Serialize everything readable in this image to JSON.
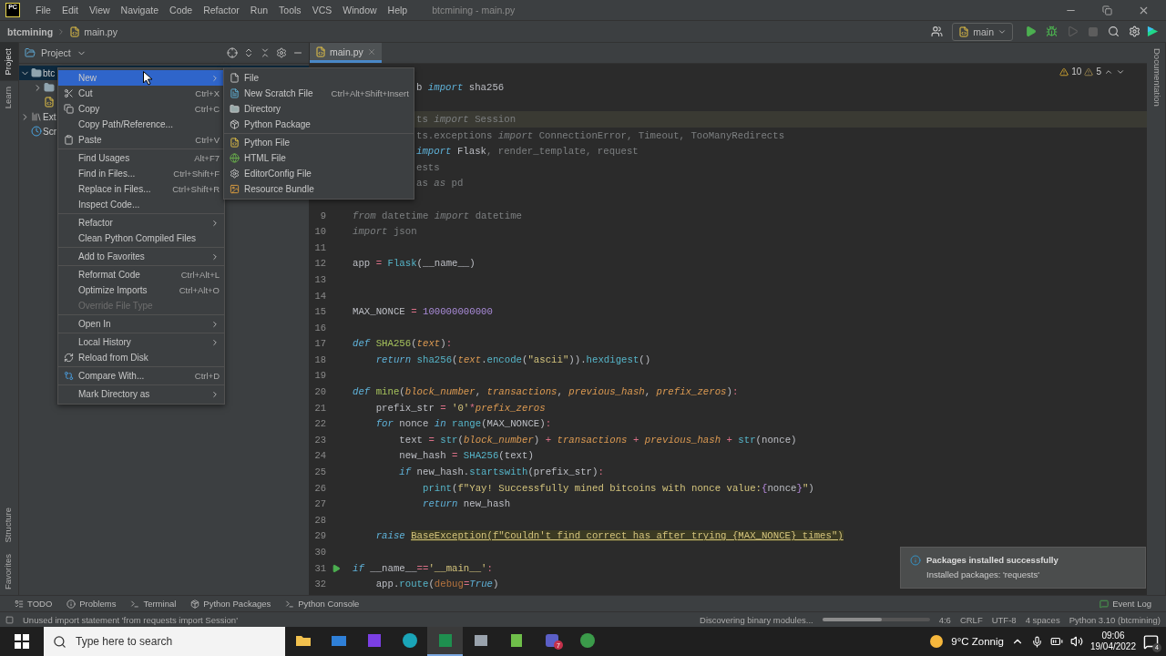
{
  "title_bar": {
    "logo": "PC",
    "menus": [
      "File",
      "Edit",
      "View",
      "Navigate",
      "Code",
      "Refactor",
      "Run",
      "Tools",
      "VCS",
      "Window",
      "Help"
    ],
    "title": "btcmining - main.py"
  },
  "nav_bar": {
    "breadcrumb": [
      "btcmining",
      "main.py"
    ],
    "run_config": "main",
    "toolbar": [
      {
        "kind": "run",
        "disabled": false
      },
      {
        "kind": "debug",
        "disabled": false
      },
      {
        "kind": "coverage",
        "disabled": true
      },
      {
        "kind": "stop",
        "disabled": true
      },
      {
        "kind": "search",
        "disabled": false
      },
      {
        "kind": "settings",
        "disabled": false
      }
    ]
  },
  "left_stripe": {
    "top": [
      {
        "label": "Project",
        "selected": true
      },
      {
        "label": "Learn",
        "selected": false
      }
    ],
    "bottom": [
      {
        "label": "Structure",
        "selected": false
      },
      {
        "label": "Favorites",
        "selected": false
      }
    ]
  },
  "right_stripe": {
    "label": "Documentation"
  },
  "project_panel": {
    "title": "Project",
    "tree": [
      {
        "kind": "folder",
        "label": "btc",
        "expanded": true,
        "selected": true,
        "children": [
          {
            "kind": "folder",
            "expanded": false
          },
          {
            "kind": "file"
          }
        ]
      },
      {
        "kind": "library",
        "label": "Ext",
        "expanded": false,
        "selected": false
      },
      {
        "kind": "scratches",
        "selected": false,
        "label": "Scr"
      }
    ]
  },
  "editor": {
    "tab": {
      "label": "main.py",
      "selected": true
    },
    "warnings": "10",
    "weak_warnings": "5",
    "lines": [
      {
        "kind": "partial",
        "tokens": [
          {
            "text": "b ",
            "kind": "plain"
          },
          {
            "text": "import",
            "kind": "keyword"
          },
          {
            "text": " sha256",
            "kind": "plain"
          }
        ]
      },
      {
        "kind": "blank"
      },
      {
        "kind": "caret",
        "tokens": [
          {
            "text": "ts ",
            "kind": "unused"
          },
          {
            "text": "import",
            "kind": "unused_keyword"
          },
          {
            "text": " Session",
            "kind": "unused"
          }
        ]
      },
      {
        "kind": "partial",
        "tokens": [
          {
            "text": "ts.exceptions ",
            "kind": "unused"
          },
          {
            "text": "import",
            "kind": "unused_keyword"
          },
          {
            "text": " ConnectionError, Timeout, TooManyRedirects",
            "kind": "unused"
          }
        ]
      },
      {
        "kind": "partial",
        "tokens": [
          {
            "text": "import",
            "kind": "keyword"
          },
          {
            "text": " Flask",
            "kind": "plain"
          },
          {
            "text": ", render_template, request",
            "kind": "unused"
          }
        ]
      },
      {
        "kind": "partial",
        "tokens": [
          {
            "text": "ests",
            "kind": "unused"
          }
        ]
      },
      {
        "kind": "partial",
        "tokens": [
          {
            "text": "as ",
            "kind": "unused"
          },
          {
            "text": "as",
            "kind": "unused_keyword"
          },
          {
            "text": " pd",
            "kind": "unused"
          }
        ]
      },
      {
        "kind": "blank"
      },
      {
        "kind": "code",
        "number": "9",
        "tokens": [
          {
            "text": "from",
            "kind": "unused_keyword"
          },
          {
            "text": " datetime ",
            "kind": "unused"
          },
          {
            "text": "import",
            "kind": "unused_keyword"
          },
          {
            "text": " datetime",
            "kind": "unused"
          }
        ]
      },
      {
        "kind": "code",
        "number": "10",
        "tokens": [
          {
            "text": "import",
            "kind": "unused_keyword"
          },
          {
            "text": " json",
            "kind": "unused"
          }
        ]
      },
      {
        "kind": "code",
        "number": "11"
      },
      {
        "kind": "code",
        "number": "12",
        "tokens": [
          {
            "text": "app ",
            "kind": "plain"
          },
          {
            "text": "= ",
            "kind": "operator"
          },
          {
            "text": "Flask",
            "kind": "call"
          },
          {
            "text": "(__name__)",
            "kind": "plain"
          }
        ]
      },
      {
        "kind": "code",
        "number": "13"
      },
      {
        "kind": "code",
        "number": "14"
      },
      {
        "kind": "code",
        "number": "15",
        "tokens": [
          {
            "text": "MAX_NONCE ",
            "kind": "plain"
          },
          {
            "text": "= ",
            "kind": "operator"
          },
          {
            "text": "100000000000",
            "kind": "number"
          }
        ]
      },
      {
        "kind": "code",
        "number": "16"
      },
      {
        "kind": "code",
        "number": "17",
        "tokens": [
          {
            "text": "def ",
            "kind": "keyword"
          },
          {
            "text": "SHA256",
            "kind": "function"
          },
          {
            "text": "(",
            "kind": "plain"
          },
          {
            "text": "text",
            "kind": "param"
          },
          {
            "text": ")",
            "kind": "plain"
          },
          {
            "text": ":",
            "kind": "operator"
          }
        ]
      },
      {
        "kind": "code",
        "number": "18",
        "tokens": [
          {
            "text": "    return ",
            "kind": "keyword"
          },
          {
            "text": "sha256",
            "kind": "call"
          },
          {
            "text": "(",
            "kind": "plain"
          },
          {
            "text": "text",
            "kind": "param"
          },
          {
            "text": ".",
            "kind": "plain"
          },
          {
            "text": "encode",
            "kind": "call"
          },
          {
            "text": "(",
            "kind": "plain"
          },
          {
            "text": "\"ascii\"",
            "kind": "string"
          },
          {
            "text": ")).",
            "kind": "plain"
          },
          {
            "text": "hexdigest",
            "kind": "call"
          },
          {
            "text": "()",
            "kind": "plain"
          }
        ]
      },
      {
        "kind": "code",
        "number": "19"
      },
      {
        "kind": "code",
        "number": "20",
        "tokens": [
          {
            "text": "def ",
            "kind": "keyword"
          },
          {
            "text": "mine",
            "kind": "function"
          },
          {
            "text": "(",
            "kind": "plain"
          },
          {
            "text": "block_number",
            "kind": "param"
          },
          {
            "text": ", ",
            "kind": "plain"
          },
          {
            "text": "transactions",
            "kind": "param"
          },
          {
            "text": ", ",
            "kind": "plain"
          },
          {
            "text": "previous_hash",
            "kind": "param"
          },
          {
            "text": ", ",
            "kind": "plain"
          },
          {
            "text": "prefix_zeros",
            "kind": "param"
          },
          {
            "text": ")",
            "kind": "plain"
          },
          {
            "text": ":",
            "kind": "operator"
          }
        ]
      },
      {
        "kind": "code",
        "number": "21",
        "tokens": [
          {
            "text": "    prefix_str ",
            "kind": "plain"
          },
          {
            "text": "= ",
            "kind": "operator"
          },
          {
            "text": "'0'",
            "kind": "string"
          },
          {
            "text": "*",
            "kind": "operator"
          },
          {
            "text": "prefix_zeros",
            "kind": "param"
          }
        ]
      },
      {
        "kind": "code",
        "number": "22",
        "tokens": [
          {
            "text": "    for",
            "kind": "keyword"
          },
          {
            "text": " nonce ",
            "kind": "plain"
          },
          {
            "text": "in ",
            "kind": "keyword"
          },
          {
            "text": "range",
            "kind": "call"
          },
          {
            "text": "(MAX_NONCE)",
            "kind": "plain"
          },
          {
            "text": ":",
            "kind": "operator"
          }
        ]
      },
      {
        "kind": "code",
        "number": "23",
        "tokens": [
          {
            "text": "        text ",
            "kind": "plain"
          },
          {
            "text": "= ",
            "kind": "operator"
          },
          {
            "text": "str",
            "kind": "call"
          },
          {
            "text": "(",
            "kind": "plain"
          },
          {
            "text": "block_number",
            "kind": "param"
          },
          {
            "text": ") ",
            "kind": "plain"
          },
          {
            "text": "+ ",
            "kind": "operator"
          },
          {
            "text": "transactions ",
            "kind": "param"
          },
          {
            "text": "+ ",
            "kind": "operator"
          },
          {
            "text": "previous_hash ",
            "kind": "param"
          },
          {
            "text": "+ ",
            "kind": "operator"
          },
          {
            "text": "str",
            "kind": "call"
          },
          {
            "text": "(nonce)",
            "kind": "plain"
          }
        ]
      },
      {
        "kind": "code",
        "number": "24",
        "tokens": [
          {
            "text": "        new_hash ",
            "kind": "plain"
          },
          {
            "text": "= ",
            "kind": "operator"
          },
          {
            "text": "SHA256",
            "kind": "call"
          },
          {
            "text": "(text)",
            "kind": "plain"
          }
        ]
      },
      {
        "kind": "code",
        "number": "25",
        "tokens": [
          {
            "text": "        if",
            "kind": "keyword"
          },
          {
            "text": " new_hash.",
            "kind": "plain"
          },
          {
            "text": "startswith",
            "kind": "call"
          },
          {
            "text": "(prefix_str)",
            "kind": "plain"
          },
          {
            "text": ":",
            "kind": "operator"
          }
        ]
      },
      {
        "kind": "code",
        "number": "26",
        "tokens": [
          {
            "text": "            print",
            "kind": "call"
          },
          {
            "text": "(",
            "kind": "plain"
          },
          {
            "text": "f\"Yay! Successfully mined bitcoins with nonce value:",
            "kind": "string"
          },
          {
            "text": "{",
            "kind": "brace"
          },
          {
            "text": "nonce",
            "kind": "plain"
          },
          {
            "text": "}",
            "kind": "brace"
          },
          {
            "text": "\"",
            "kind": "string"
          },
          {
            "text": ")",
            "kind": "plain"
          }
        ]
      },
      {
        "kind": "code",
        "number": "27",
        "tokens": [
          {
            "text": "            return",
            "kind": "keyword"
          },
          {
            "text": " new_hash",
            "kind": "plain"
          }
        ]
      },
      {
        "kind": "code",
        "number": "28"
      },
      {
        "kind": "code",
        "number": "29",
        "tokens": [
          {
            "text": "    raise ",
            "kind": "keyword"
          },
          {
            "text": "BaseException(f\"Couldn't find correct has after trying {MAX_NONCE} times\")",
            "kind": "highlight"
          }
        ]
      },
      {
        "kind": "code",
        "number": "30"
      },
      {
        "kind": "entry",
        "number": "31",
        "tokens": [
          {
            "text": "if",
            "kind": "keyword"
          },
          {
            "text": " __name__",
            "kind": "plain"
          },
          {
            "text": "==",
            "kind": "operator"
          },
          {
            "text": "'__main__'",
            "kind": "string"
          },
          {
            "text": ":",
            "kind": "operator"
          }
        ]
      },
      {
        "kind": "code",
        "number": "32",
        "tokens": [
          {
            "text": "    app.",
            "kind": "plain"
          },
          {
            "text": "route",
            "kind": "call"
          },
          {
            "text": "(",
            "kind": "plain"
          },
          {
            "text": "debug",
            "kind": "named_arg"
          },
          {
            "text": "=",
            "kind": "operator"
          },
          {
            "text": "True",
            "kind": "keyword"
          },
          {
            "text": ")",
            "kind": "plain"
          }
        ]
      }
    ]
  },
  "context_menu": {
    "groups": [
      [
        {
          "label": "New",
          "has_submenu": true,
          "selected": true,
          "disabled": false
        },
        {
          "label": "Cut",
          "shortcut": "Ctrl+X",
          "has_submenu": false,
          "selected": false,
          "disabled": false
        },
        {
          "label": "Copy",
          "shortcut": "Ctrl+C",
          "has_submenu": false,
          "selected": false,
          "disabled": false
        },
        {
          "label": "Copy Path/Reference...",
          "has_submenu": false,
          "selected": false,
          "disabled": false
        },
        {
          "label": "Paste",
          "shortcut": "Ctrl+V",
          "has_submenu": false,
          "selected": false,
          "disabled": false
        }
      ],
      [
        {
          "label": "Find Usages",
          "shortcut": "Alt+F7",
          "has_submenu": false,
          "selected": false,
          "disabled": false
        },
        {
          "label": "Find in Files...",
          "shortcut": "Ctrl+Shift+F",
          "has_submenu": false,
          "selected": false,
          "disabled": false
        },
        {
          "label": "Replace in Files...",
          "shortcut": "Ctrl+Shift+R",
          "has_submenu": false,
          "selected": false,
          "disabled": false
        },
        {
          "label": "Inspect Code...",
          "has_submenu": false,
          "selected": false,
          "disabled": false
        }
      ],
      [
        {
          "label": "Refactor",
          "has_submenu": true,
          "selected": false,
          "disabled": false
        },
        {
          "label": "Clean Python Compiled Files",
          "has_submenu": false,
          "selected": false,
          "disabled": false
        }
      ],
      [
        {
          "label": "Add to Favorites",
          "has_submenu": true,
          "selected": false,
          "disabled": false
        }
      ],
      [
        {
          "label": "Reformat Code",
          "shortcut": "Ctrl+Alt+L",
          "has_submenu": false,
          "selected": false,
          "disabled": false
        },
        {
          "label": "Optimize Imports",
          "shortcut": "Ctrl+Alt+O",
          "has_submenu": false,
          "selected": false,
          "disabled": false
        },
        {
          "label": "Override File Type",
          "has_submenu": false,
          "selected": false,
          "disabled": true
        }
      ],
      [
        {
          "label": "Open In",
          "has_submenu": true,
          "selected": false,
          "disabled": false
        }
      ],
      [
        {
          "label": "Local History",
          "has_submenu": true,
          "selected": false,
          "disabled": false
        },
        {
          "label": "Reload from Disk",
          "has_submenu": false,
          "selected": false,
          "disabled": false
        }
      ],
      [
        {
          "label": "Compare With...",
          "shortcut": "Ctrl+D",
          "has_submenu": false,
          "selected": false,
          "disabled": false
        }
      ],
      [
        {
          "label": "Mark Directory as",
          "has_submenu": true,
          "selected": false,
          "disabled": false
        }
      ]
    ]
  },
  "submenu": {
    "groups": [
      [
        {
          "label": "File"
        },
        {
          "label": "New Scratch File",
          "shortcut": "Ctrl+Alt+Shift+Insert"
        },
        {
          "label": "Directory"
        },
        {
          "label": "Python Package"
        }
      ],
      [
        {
          "label": "Python File"
        },
        {
          "label": "HTML File"
        },
        {
          "label": "EditorConfig File"
        },
        {
          "label": "Resource Bundle"
        }
      ]
    ]
  },
  "notification": {
    "title": "Packages installed successfully",
    "body": "Installed packages: 'requests'"
  },
  "tool_tabs": [
    "TODO",
    "Problems",
    "Terminal",
    "Python Packages",
    "Python Console"
  ],
  "event_log": "Event Log",
  "status_bar": {
    "message": "Unused import statement 'from requests import Session'",
    "task": "Discovering binary modules...",
    "level": 0.55,
    "items": [
      "4:6",
      "CRLF",
      "UTF-8",
      "4 spaces",
      "Python 3.10 (btcmining)"
    ]
  },
  "taskbar": {
    "search_placeholder": "Type here to search",
    "apps": [
      {
        "selected": false
      },
      {
        "selected": false
      },
      {
        "selected": false
      },
      {
        "selected": false
      },
      {
        "selected": true
      },
      {
        "selected": false
      },
      {
        "selected": false
      },
      {
        "selected": false,
        "badge": "7"
      },
      {
        "selected": false
      }
    ],
    "weather": "9°C Zonnig",
    "time": "09:06",
    "date": "19/04/2022",
    "notifications": "4"
  }
}
